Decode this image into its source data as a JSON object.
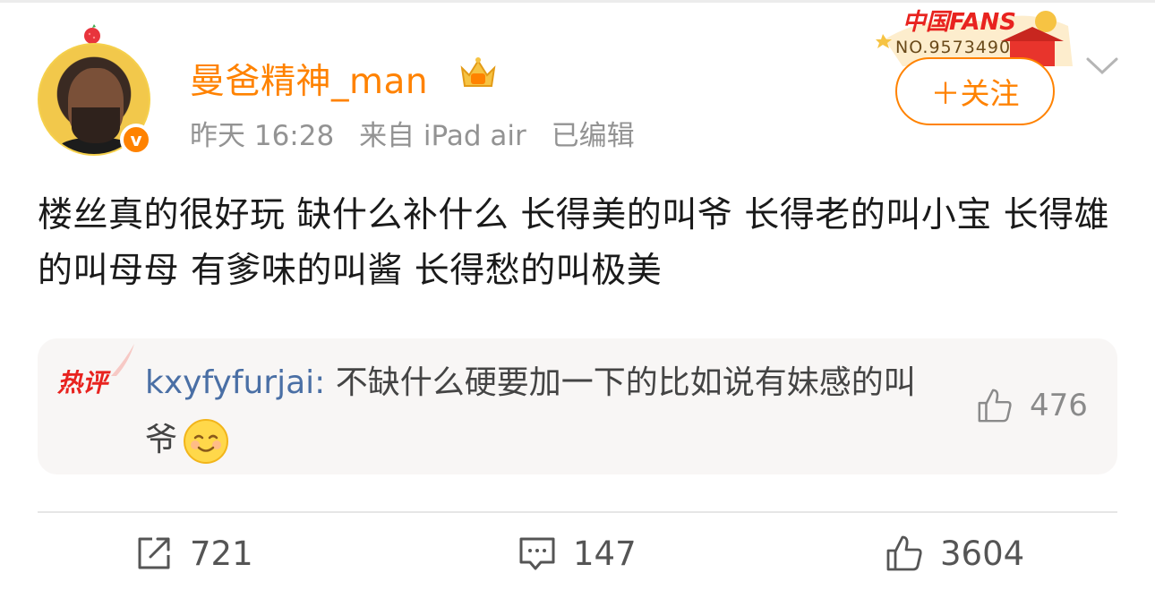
{
  "author": {
    "name": "曼爸精神_man",
    "verified_mark": "v"
  },
  "meta": {
    "time": "昨天 16:28",
    "source": "来自 iPad air",
    "edited": "已编辑"
  },
  "fans_badge": {
    "label": "中国FANS",
    "number": "NO.9573490"
  },
  "follow_button": "＋关注",
  "post_text": "楼丝真的很好玩 缺什么补什么 长得美的叫爷 长得老的叫小宝 长得雄的叫母母 有爹味的叫酱 长得愁的叫极美",
  "hot_comment": {
    "tag": "热评",
    "user": "kxyfyfurjai:",
    "text": " 不缺什么硬要加一下的比如说有妹感的叫爷",
    "likes": "476"
  },
  "actions": {
    "repost_count": "721",
    "comment_count": "147",
    "like_count": "3604"
  },
  "colors": {
    "accent": "#ff8200",
    "hot": "#e8231f",
    "link": "#4a6fa5"
  }
}
